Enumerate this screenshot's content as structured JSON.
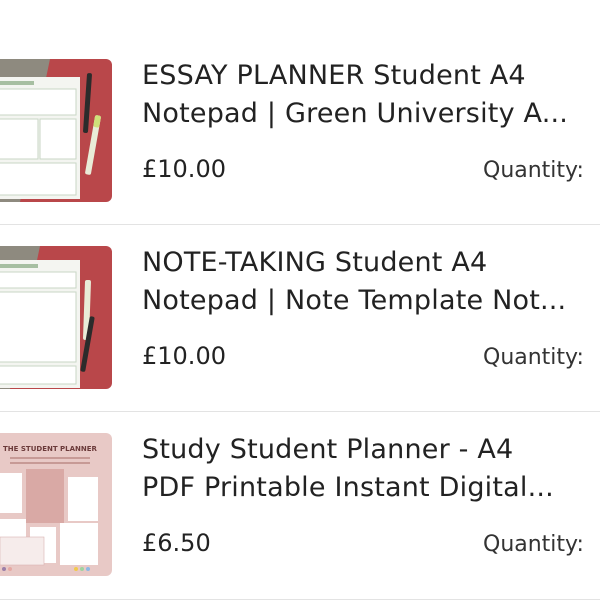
{
  "cart": {
    "items": [
      {
        "title_line1": "ESSAY PLANNER Student A4",
        "title_line2": "Notepad | Green University A...",
        "price": "£10.00",
        "quantity_label": "Quantity:",
        "thumbnail": "essay-planner-notepad-photo"
      },
      {
        "title_line1": "NOTE-TAKING Student A4",
        "title_line2": "Notepad | Note Template Not...",
        "price": "£10.00",
        "quantity_label": "Quantity:",
        "thumbnail": "note-taking-notepad-photo"
      },
      {
        "title_line1": "Study Student Planner - A4",
        "title_line2": "PDF Printable Instant Digital...",
        "price": "£6.50",
        "quantity_label": "Quantity:",
        "thumbnail": "student-planner-printable-preview",
        "thumbnail_text": "THE STUDENT PLANNER"
      }
    ]
  },
  "colors": {
    "background": "#ffffff",
    "text": "#222222",
    "divider": "#e3e3e3",
    "thumb_red": "#b9474a",
    "thumb_gray": "#8e8a7f",
    "thumb_pink": "#e8c9c6"
  }
}
